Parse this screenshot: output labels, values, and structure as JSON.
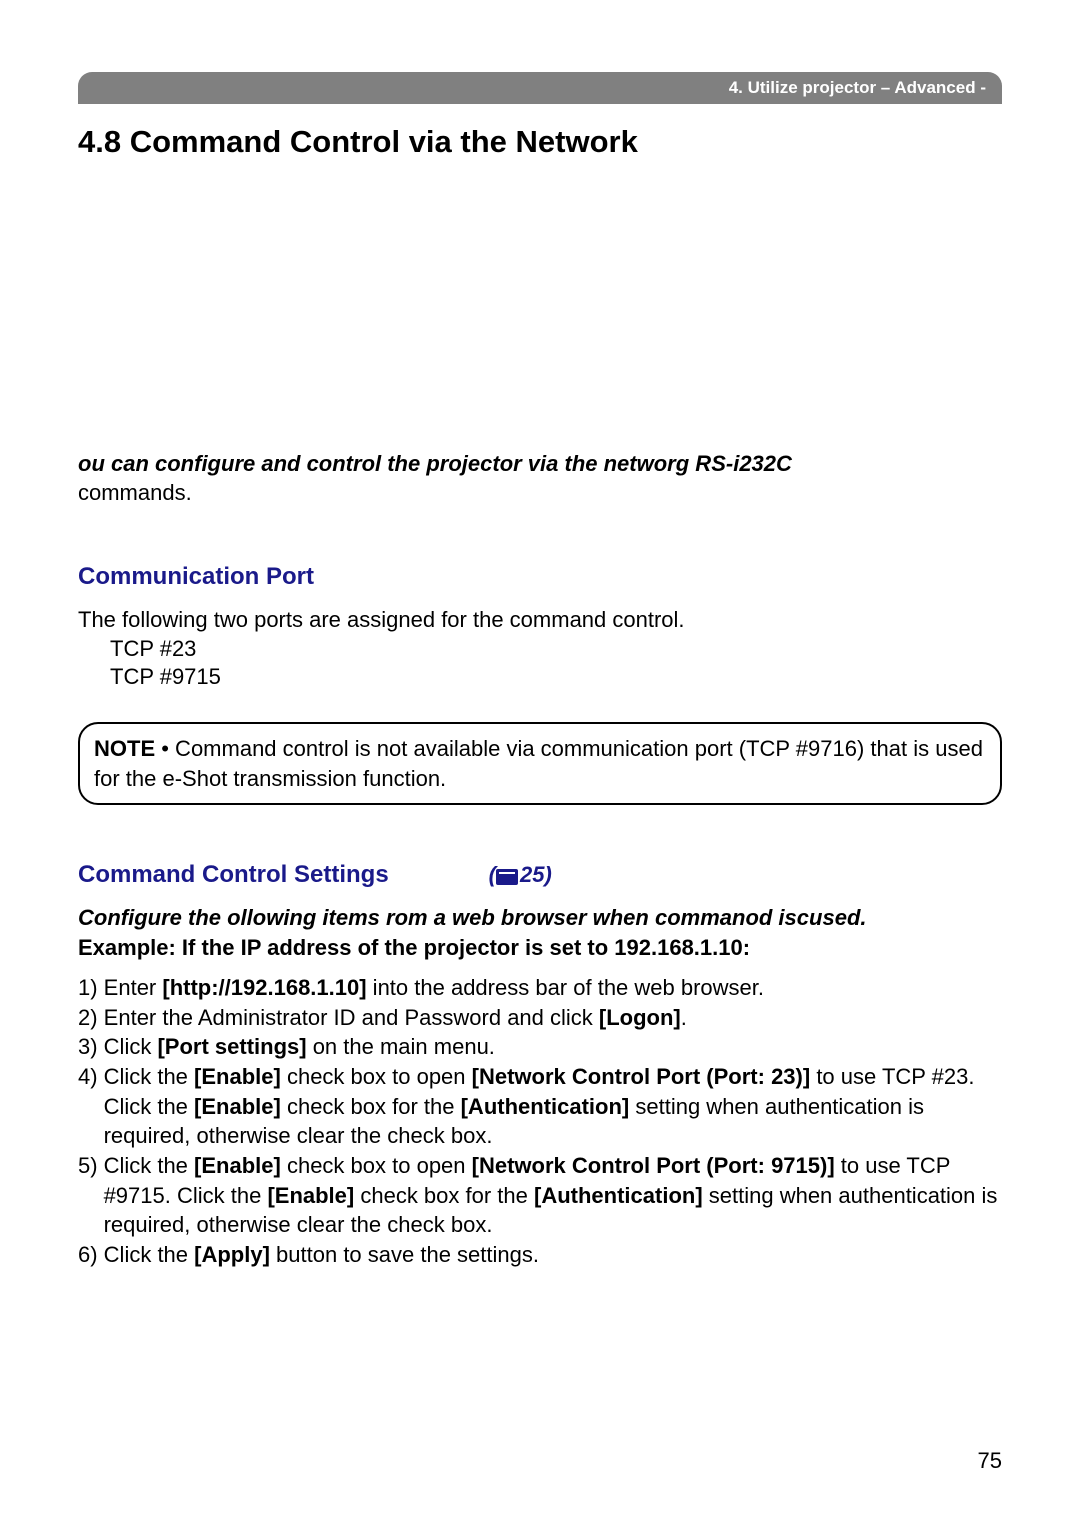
{
  "header": {
    "breadcrumb": "4. Utilize projector – Advanced -"
  },
  "section": {
    "title": "4.8 Command Control via the Network"
  },
  "intro": {
    "line1_part1": "ou can configure and control the projector via the networ",
    "line1_part2": "g R",
    "line1_part3": "S-i",
    "line1_part4": "232C",
    "commands": "commands."
  },
  "communication_port": {
    "heading": "Communication Port",
    "description": "The following two ports are assigned for the command control.",
    "ports": [
      "TCP #23",
      "TCP #9715"
    ]
  },
  "note": {
    "label": "NOTE",
    "text": " • Command control is not available via communication port (TCP #9716) that is used for the e-Shot transmission function."
  },
  "command_control_settings": {
    "heading": "Command Control Settings",
    "page_ref": "25",
    "configure_part1": "Configure the ",
    "configure_part2": " ollowing items ",
    "configure_part3": " rom a web browser when comm",
    "configure_part4": "anod is",
    "configure_part5": "c",
    "configure_part6": "used.",
    "example": "Example: If the IP address of the projector is set to 192.168.1.10:"
  },
  "steps": {
    "s1_a": "1) Enter ",
    "s1_b": "[http://192.168.1.10]",
    "s1_c": " into the address bar of the web browser.",
    "s2_a": "2) Enter the Administrator ID and Password and click ",
    "s2_b": "[Logon]",
    "s2_c": ".",
    "s3_a": "3) Click ",
    "s3_b": "[Port settings]",
    "s3_c": " on the main menu.",
    "s4_num": "4) ",
    "s4_a": "Click the ",
    "s4_b": "[Enable]",
    "s4_c": " check box to open ",
    "s4_d": "[Network Control Port (Port: 23)]",
    "s4_e": " to use TCP #23. Click the ",
    "s4_f": "[Enable]",
    "s4_g": " check box for the ",
    "s4_h": "[Authentication]",
    "s4_i": " setting when authentication is required, otherwise clear the check box.",
    "s5_num": "5) ",
    "s5_a": "Click the ",
    "s5_b": "[Enable]",
    "s5_c": " check box to open ",
    "s5_d": "[Network Control Port (Port: 9715)]",
    "s5_e": " to use TCP #9715. Click the ",
    "s5_f": "[Enable]",
    "s5_g": " check box for the ",
    "s5_h": "[Authentication]",
    "s5_i": " setting when authentication is required, otherwise clear the check box.",
    "s6_a": "6) Click the ",
    "s6_b": "[Apply]",
    "s6_c": " button to save the settings."
  },
  "page_number": "75"
}
